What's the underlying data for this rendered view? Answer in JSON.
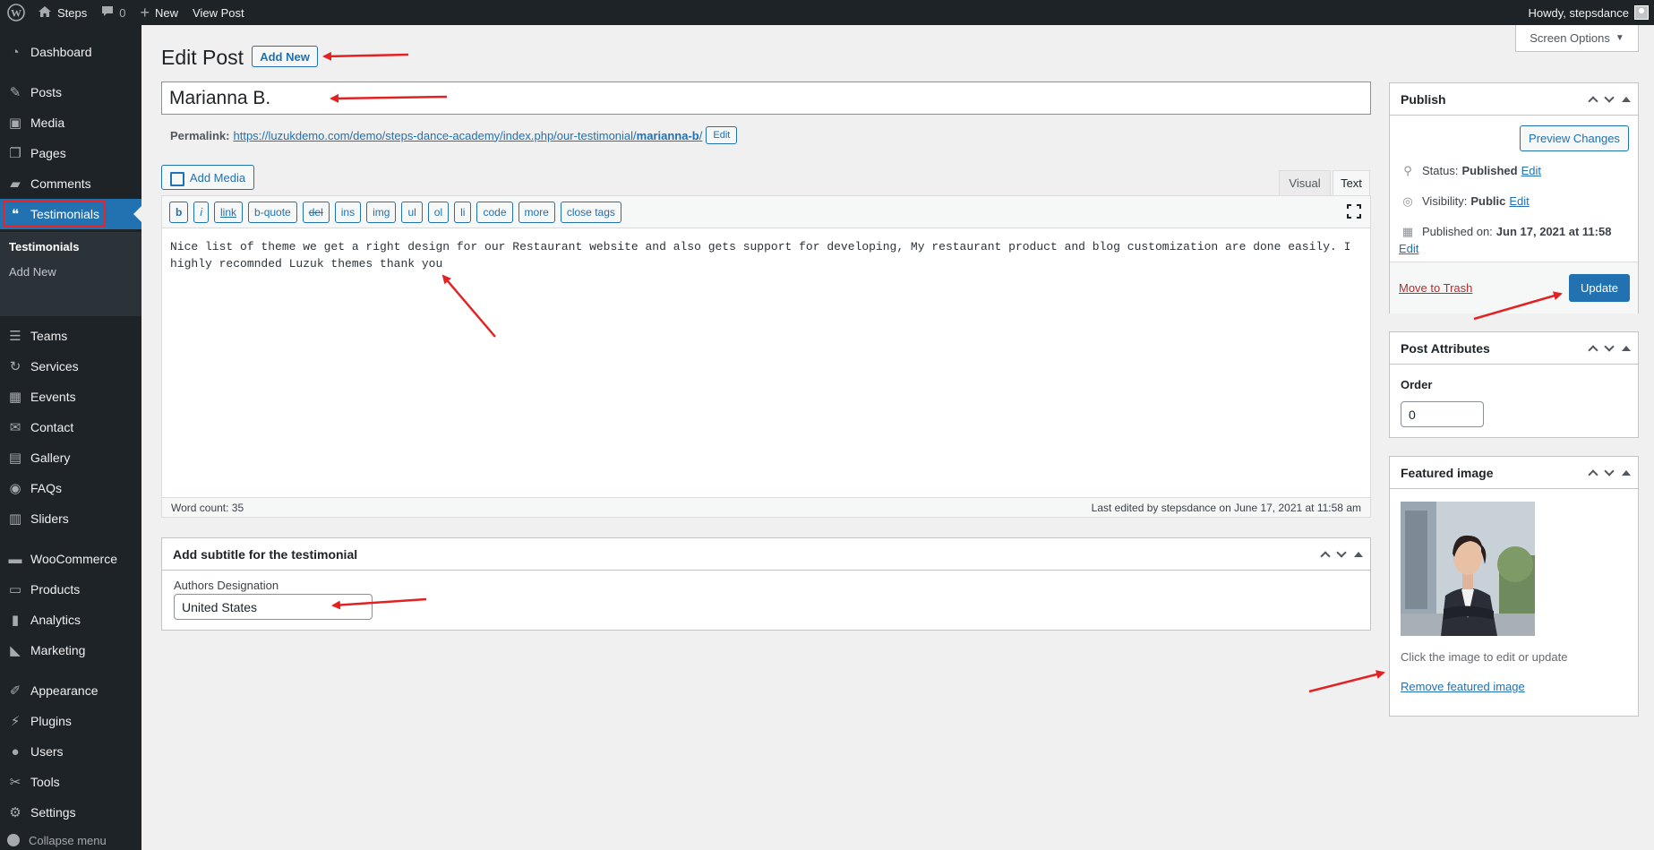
{
  "adminbar": {
    "site_name": "Steps",
    "comment_count": "0",
    "new_label": "New",
    "view_post_label": "View Post",
    "greeting": "Howdy, stepsdance"
  },
  "sidebar": {
    "items": [
      {
        "label": "Dashboard",
        "icon": "dashboard-icon"
      },
      {
        "label": "Posts",
        "icon": "pin-icon"
      },
      {
        "label": "Media",
        "icon": "media-icon"
      },
      {
        "label": "Pages",
        "icon": "pages-icon"
      },
      {
        "label": "Comments",
        "icon": "comment-icon"
      },
      {
        "label": "Testimonials",
        "icon": "testimonial-icon"
      },
      {
        "label": "Teams",
        "icon": "groups-icon"
      },
      {
        "label": "Services",
        "icon": "update-icon"
      },
      {
        "label": "Eevents",
        "icon": "grid-icon"
      },
      {
        "label": "Contact",
        "icon": "email-icon"
      },
      {
        "label": "Gallery",
        "icon": "gallery-icon"
      },
      {
        "label": "FAQs",
        "icon": "faq-icon"
      },
      {
        "label": "Sliders",
        "icon": "sliders-icon"
      },
      {
        "label": "WooCommerce",
        "icon": "woo-icon"
      },
      {
        "label": "Products",
        "icon": "archive-icon"
      },
      {
        "label": "Analytics",
        "icon": "chart-icon"
      },
      {
        "label": "Marketing",
        "icon": "megaphone-icon"
      },
      {
        "label": "Appearance",
        "icon": "brush-icon"
      },
      {
        "label": "Plugins",
        "icon": "plugin-icon"
      },
      {
        "label": "Users",
        "icon": "user-icon"
      },
      {
        "label": "Tools",
        "icon": "wrench-icon"
      },
      {
        "label": "Settings",
        "icon": "settings-icon"
      }
    ],
    "submenu": [
      "Testimonials",
      "Add New"
    ],
    "collapse_label": "Collapse menu"
  },
  "header": {
    "screen_options": "Screen Options",
    "page_title": "Edit Post",
    "add_new": "Add New"
  },
  "post": {
    "title": "Marianna B.",
    "permalink_label": "Permalink:",
    "permalink_base": "https://luzukdemo.com/demo/steps-dance-academy/index.php/our-testimonial/",
    "permalink_slug": "marianna-b",
    "permalink_end": "/",
    "permalink_edit": "Edit"
  },
  "editor": {
    "add_media": "Add Media",
    "tab_visual": "Visual",
    "tab_text": "Text",
    "buttons": [
      "b",
      "i",
      "link",
      "b-quote",
      "del",
      "ins",
      "img",
      "ul",
      "ol",
      "li",
      "code",
      "more",
      "close tags"
    ],
    "content": "Nice list of theme we get a right design for our Restaurant website and also gets support for developing, My restaurant product and blog customization are done easily. I highly recomnded Luzuk themes thank you",
    "word_count": "Word count: 35",
    "last_edited": "Last edited by stepsdance on June 17, 2021 at 11:58 am"
  },
  "subtitle_box": {
    "title": "Add subtitle for the testimonial",
    "field_label": "Authors Designation",
    "field_value": "United States"
  },
  "publish": {
    "title": "Publish",
    "preview": "Preview Changes",
    "status_label": "Status:",
    "status_value": "Published",
    "visibility_label": "Visibility:",
    "visibility_value": "Public",
    "published_label": "Published on:",
    "published_value": "Jun 17, 2021 at 11:58",
    "edit": "Edit",
    "trash": "Move to Trash",
    "update": "Update"
  },
  "attributes": {
    "title": "Post Attributes",
    "order_label": "Order",
    "order_value": "0"
  },
  "featured": {
    "title": "Featured image",
    "hint": "Click the image to edit or update",
    "remove": "Remove featured image"
  },
  "colors": {
    "accent": "#2271b1",
    "sidebar_bg": "#1d2327",
    "annotation": "#e22222"
  }
}
